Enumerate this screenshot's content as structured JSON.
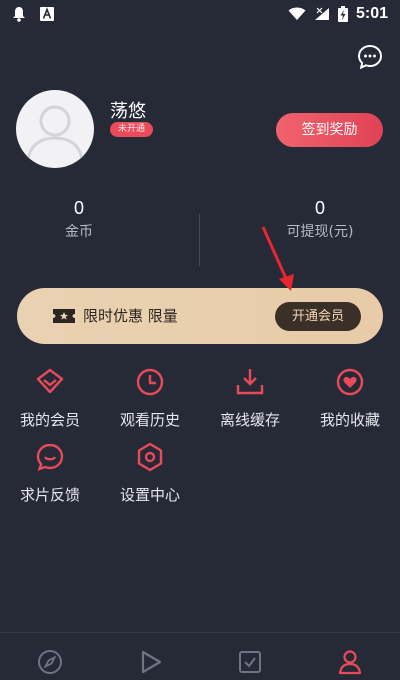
{
  "status_bar": {
    "time": "5:01"
  },
  "profile": {
    "username": "荡悠",
    "vip_status": "未开通",
    "checkin_label": "签到奖励"
  },
  "stats": [
    {
      "value": "0",
      "label": "金币"
    },
    {
      "value": "0",
      "label": "可提现(元)"
    }
  ],
  "vip_banner": {
    "text": "限时优惠 限量",
    "button_label": "开通会员"
  },
  "menu_items": [
    {
      "label": "我的会员",
      "icon": "diamond-icon"
    },
    {
      "label": "观看历史",
      "icon": "clock-icon"
    },
    {
      "label": "离线缓存",
      "icon": "download-icon"
    },
    {
      "label": "我的收藏",
      "icon": "heart-icon"
    },
    {
      "label": "求片反馈",
      "icon": "feedback-icon"
    },
    {
      "label": "设置中心",
      "icon": "settings-icon"
    }
  ],
  "colors": {
    "background": "#262a37",
    "accent": "#e84a5a",
    "banner": "#e9d2b2",
    "banner_button": "#3b3028"
  },
  "tabbar": {
    "tabs": [
      {
        "icon": "compass-icon",
        "active": false
      },
      {
        "icon": "play-icon",
        "active": false
      },
      {
        "icon": "checkbox-icon",
        "active": false
      },
      {
        "icon": "person-icon",
        "active": true
      }
    ]
  }
}
